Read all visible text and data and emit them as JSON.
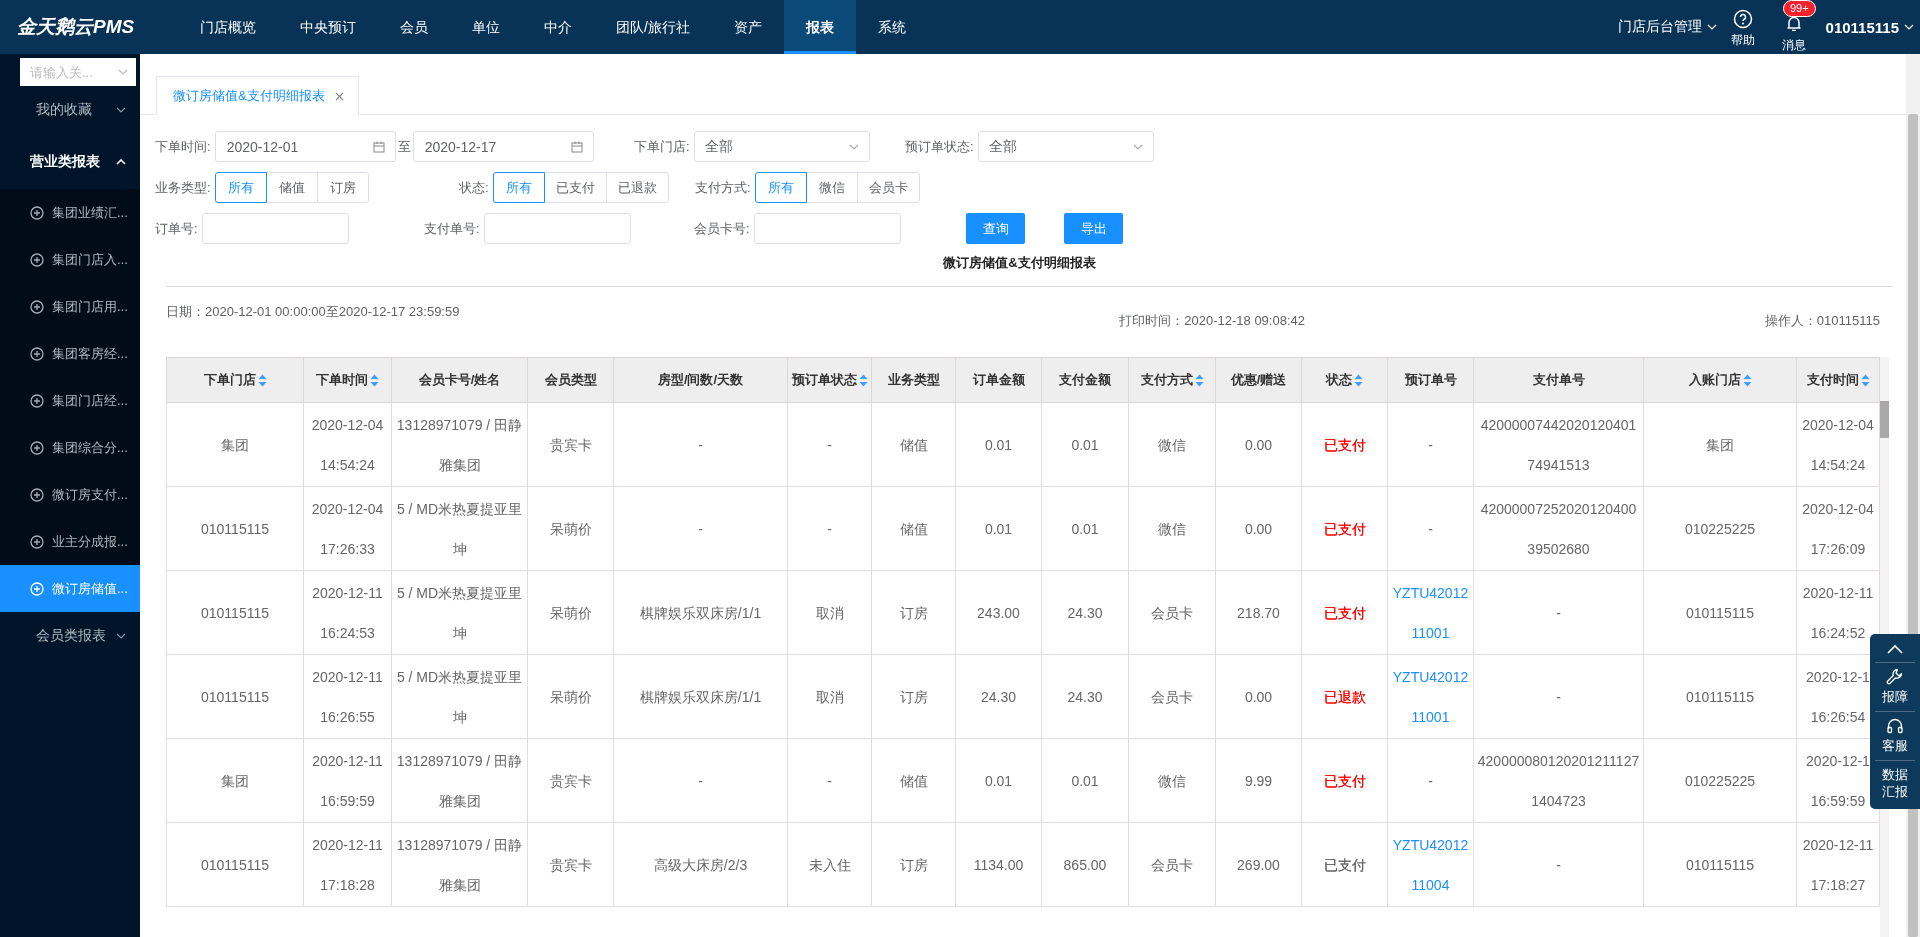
{
  "app": {
    "logo": "金天鹅云PMS"
  },
  "nav": [
    {
      "label": "门店概览",
      "selected": false
    },
    {
      "label": "中央预订",
      "selected": false
    },
    {
      "label": "会员",
      "selected": false
    },
    {
      "label": "单位",
      "selected": false
    },
    {
      "label": "中介",
      "selected": false
    },
    {
      "label": "团队/旅行社",
      "selected": false
    },
    {
      "label": "资产",
      "selected": false
    },
    {
      "label": "报表",
      "selected": true
    },
    {
      "label": "系统",
      "selected": false
    }
  ],
  "header_right": {
    "store_admin": "门店后台管理",
    "help": "帮助",
    "messages": "消息",
    "message_badge": "99+",
    "user": "010115115"
  },
  "sidebar": {
    "search_placeholder": "请输入关...",
    "groups": [
      {
        "label": "我的收藏",
        "expanded": false
      },
      {
        "label": "营业类报表",
        "expanded": true,
        "children": [
          {
            "label": "集团业绩汇...",
            "selected": false
          },
          {
            "label": "集团门店入...",
            "selected": false
          },
          {
            "label": "集团门店用...",
            "selected": false
          },
          {
            "label": "集团客房经...",
            "selected": false
          },
          {
            "label": "集团门店经...",
            "selected": false
          },
          {
            "label": "集团综合分...",
            "selected": false
          },
          {
            "label": "微订房支付...",
            "selected": false
          },
          {
            "label": "业主分成报...",
            "selected": false
          },
          {
            "label": "微订房储值...",
            "selected": true
          }
        ]
      },
      {
        "label": "会员类报表",
        "expanded": false
      }
    ]
  },
  "tabs": [
    {
      "label": "微订房储值&支付明细报表",
      "selected": true
    }
  ],
  "filters": {
    "order_time": {
      "label": "下单时间:",
      "from": "2020-12-01",
      "separator": "至",
      "to": "2020-12-17"
    },
    "store": {
      "label": "下单门店:",
      "value": "全部"
    },
    "booking_status": {
      "label": "预订单状态:",
      "value": "全部"
    },
    "business_type": {
      "label": "业务类型:",
      "options": [
        {
          "label": "所有",
          "selected": true
        },
        {
          "label": "储值",
          "selected": false
        },
        {
          "label": "订房",
          "selected": false
        }
      ]
    },
    "status": {
      "label": "状态:",
      "options": [
        {
          "label": "所有",
          "selected": true
        },
        {
          "label": "已支付",
          "selected": false
        },
        {
          "label": "已退款",
          "selected": false
        }
      ]
    },
    "pay_method": {
      "label": "支付方式:",
      "options": [
        {
          "label": "所有",
          "selected": true
        },
        {
          "label": "微信",
          "selected": false
        },
        {
          "label": "会员卡",
          "selected": false
        }
      ]
    },
    "order_no": {
      "label": "订单号:"
    },
    "pay_no": {
      "label": "支付单号:"
    },
    "card_no": {
      "label": "会员卡号:"
    },
    "buttons": [
      "查询",
      "导出"
    ]
  },
  "report": {
    "title": "微订房储值&支付明细报表",
    "date_range": "日期：2020-12-01 00:00:00至2020-12-17 23:59:59",
    "print_time": "打印时间：2020-12-18 09:08:42",
    "operator": "操作人：010115115"
  },
  "table": {
    "columns": [
      {
        "label": "下单门店",
        "sortable": true
      },
      {
        "label": "下单时间",
        "sortable": true
      },
      {
        "label": "会员卡号/姓名",
        "sortable": false
      },
      {
        "label": "会员类型",
        "sortable": false
      },
      {
        "label": "房型/间数/天数",
        "sortable": false
      },
      {
        "label": "预订单状态",
        "sortable": true
      },
      {
        "label": "业务类型",
        "sortable": false
      },
      {
        "label": "订单金额",
        "sortable": false
      },
      {
        "label": "支付金额",
        "sortable": false
      },
      {
        "label": "支付方式",
        "sortable": true
      },
      {
        "label": "优惠/赠送",
        "sortable": false
      },
      {
        "label": "状态",
        "sortable": true
      },
      {
        "label": "预订单号",
        "sortable": false
      },
      {
        "label": "支付单号",
        "sortable": false
      },
      {
        "label": "入账门店",
        "sortable": true
      },
      {
        "label": "支付时间",
        "sortable": true
      }
    ],
    "rows": [
      {
        "cells": [
          "集团",
          "2020-12-04 14:54:24",
          "13128971079 / 田静雅集团",
          "贵宾卡",
          "-",
          "-",
          "储值",
          "0.01",
          "0.01",
          "微信",
          "0.00",
          {
            "text": "已支付",
            "color": "#ff0000"
          },
          {
            "text": "-",
            "link": false
          },
          "4200000744202012040174941513",
          "集团",
          "2020-12-04 14:54:24"
        ]
      },
      {
        "cells": [
          "010115115",
          "2020-12-04 17:26:33",
          "5 / MD米热夏提亚里坤",
          "呆萌价",
          "-",
          "-",
          "储值",
          "0.01",
          "0.01",
          "微信",
          "0.00",
          {
            "text": "已支付",
            "color": "#ff0000"
          },
          {
            "text": "-",
            "link": false
          },
          "4200000725202012040039502680",
          "010225225",
          "2020-12-04 17:26:09"
        ]
      },
      {
        "cells": [
          "010115115",
          "2020-12-11 16:24:53",
          "5 / MD米热夏提亚里坤",
          "呆萌价",
          "棋牌娱乐双床房/1/1",
          "取消",
          "订房",
          "243.00",
          "24.30",
          "会员卡",
          "218.70",
          {
            "text": "已支付",
            "color": "#ff0000"
          },
          {
            "text": "YZTU4201211001",
            "link": true
          },
          "-",
          "010115115",
          "2020-12-11 16:24:52"
        ]
      },
      {
        "cells": [
          "010115115",
          "2020-12-11 16:26:55",
          "5 / MD米热夏提亚里坤",
          "呆萌价",
          "棋牌娱乐双床房/1/1",
          "取消",
          "订房",
          "24.30",
          "24.30",
          "会员卡",
          "0.00",
          {
            "text": "已退款",
            "color": "#ff0000"
          },
          {
            "text": "YZTU4201211001",
            "link": true
          },
          "-",
          "010115115",
          "2020-12-1 16:26:54"
        ]
      },
      {
        "cells": [
          "集团",
          "2020-12-11 16:59:59",
          "13128971079 / 田静雅集团",
          "贵宾卡",
          "-",
          "-",
          "储值",
          "0.01",
          "0.01",
          "微信",
          "9.99",
          {
            "text": "已支付",
            "color": "#ff0000"
          },
          {
            "text": "-",
            "link": false
          },
          "4200000801202012111271404723",
          "010225225",
          "2020-12-1 16:59:59"
        ]
      },
      {
        "cells": [
          "010115115",
          "2020-12-11 17:18:28",
          "13128971079 / 田静雅集团",
          "贵宾卡",
          "高级大床房/2/3",
          "未入住",
          "订房",
          "1134.00",
          "865.00",
          "会员卡",
          "269.00",
          {
            "text": "已支付",
            "color": "#666666"
          },
          {
            "text": "YZTU4201211004",
            "link": true
          },
          "-",
          "010115115",
          "2020-12-11 17:18:27"
        ]
      }
    ]
  },
  "float_panel": {
    "items": [
      {
        "kind": "top"
      },
      {
        "kind": "wrench",
        "label": "报障"
      },
      {
        "kind": "headset",
        "label": "客服"
      },
      {
        "kind": "text",
        "label": "数据汇报"
      }
    ]
  }
}
